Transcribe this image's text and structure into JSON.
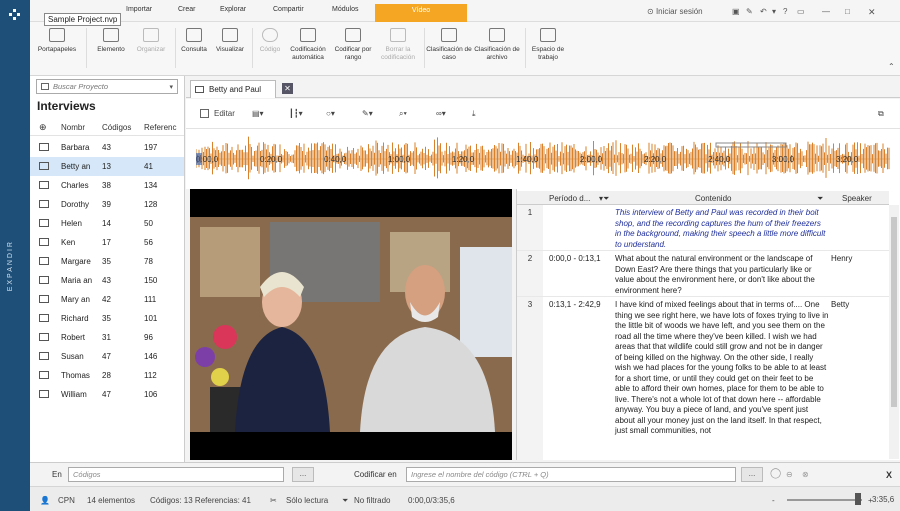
{
  "sidebar": {
    "expand_label": "EXPANDIR"
  },
  "tooltip": "Sample Project.nvp",
  "menu": {
    "tabs": [
      "Importar",
      "Crear",
      "Explorar",
      "Compartir",
      "Módulos",
      "Vídeo"
    ],
    "active": "Vídeo",
    "signin_label": "Iniciar sesión"
  },
  "ribbon": {
    "buttons": [
      "Portapapeles",
      "Elemento",
      "Organizar",
      "Consulta",
      "Visualizar",
      "Código",
      "Codificación automática",
      "Codificar por rango",
      "Borrar la codificación",
      "Clasificación de caso",
      "Clasificación de archivo",
      "Espacio de trabajo"
    ]
  },
  "nav": {
    "search_placeholder": "Buscar Proyecto",
    "title": "Interviews",
    "columns": {
      "name": "Nombr",
      "codes": "Códigos",
      "refs": "Referenc"
    },
    "rows": [
      {
        "name": "Barbara",
        "codes": "43",
        "refs": "197",
        "icon": "document-icon"
      },
      {
        "name": "Betty an",
        "codes": "13",
        "refs": "41",
        "icon": "video-icon",
        "selected": true
      },
      {
        "name": "Charles",
        "codes": "38",
        "refs": "134",
        "icon": "document-icon"
      },
      {
        "name": "Dorothy",
        "codes": "39",
        "refs": "128",
        "icon": "document-icon"
      },
      {
        "name": "Helen",
        "codes": "14",
        "refs": "50",
        "icon": "audio-icon"
      },
      {
        "name": "Ken",
        "codes": "17",
        "refs": "56",
        "icon": "video-icon"
      },
      {
        "name": "Margare",
        "codes": "35",
        "refs": "78",
        "icon": "document-icon"
      },
      {
        "name": "Maria an",
        "codes": "43",
        "refs": "150",
        "icon": "document-icon"
      },
      {
        "name": "Mary an",
        "codes": "42",
        "refs": "111",
        "icon": "document-icon"
      },
      {
        "name": "Richard",
        "codes": "35",
        "refs": "101",
        "icon": "document-icon"
      },
      {
        "name": "Robert",
        "codes": "31",
        "refs": "96",
        "icon": "document-icon"
      },
      {
        "name": "Susan",
        "codes": "47",
        "refs": "146",
        "icon": "document-icon"
      },
      {
        "name": "Thomas",
        "codes": "28",
        "refs": "112",
        "icon": "document-icon"
      },
      {
        "name": "William",
        "codes": "47",
        "refs": "106",
        "icon": "document-icon"
      }
    ]
  },
  "document": {
    "tab_label": "Betty and Paul",
    "edit_label": "Editar",
    "timeline_ticks": [
      "0:00,0",
      "0:20,0",
      "0:40,0",
      "1:00,0",
      "1:20,0",
      "1:40,0",
      "2:00,0",
      "2:20,0",
      "2:40,0",
      "3:00,0",
      "3:20,0"
    ]
  },
  "transcript": {
    "columns": {
      "range": "Período d...",
      "content": "Contenido",
      "speaker": "Speaker"
    },
    "rows": [
      {
        "num": "1",
        "range": "",
        "content": "This interview of Betty and Paul was recorded in their boit shop, and the recording captures the hum of their freezers in the background, making their speech a little more difficult to understand.",
        "speaker": "",
        "note": true
      },
      {
        "num": "2",
        "range": "0:00,0 - 0:13,1",
        "content": "What about the natural environment or the landscape of Down East? Are there things that you particularly like or value about the environment here, or don't like about the environment here?",
        "speaker": "Henry"
      },
      {
        "num": "3",
        "range": "0:13,1 - 2:42,9",
        "content": "I have kind of mixed feelings about that in terms of.... One thing we see right here, we have lots of foxes trying to live in the little bit of woods we have left, and you see them on the road all the time where they've been killed. I wish we had areas that that wildlife could still grow and not be in danger of being killed on the highway. On the other side, I really wish we had places for the young folks to be able to at least for a short time, or until they could get on their feet to be able to afford their own homes, place for them to be able to live. There's not a whole lot of that down here -- affordable anyway. You buy a piece of land, and you've spent just about all your money just on the land itself. In that respect, just small communities, not",
        "speaker": "Betty"
      }
    ]
  },
  "coding_bar": {
    "in_label": "En",
    "codes_placeholder": "Códigos",
    "code_in_label": "Codificar en",
    "code_input_placeholder": "Ingrese el nombre del código (CTRL + Q)",
    "more_label": "...",
    "close_label": "X"
  },
  "status": {
    "user": "CPN",
    "items": "14 elementos",
    "codes_refs": "Códigos: 13  Referencias: 41",
    "readonly": "Sólo lectura",
    "filter": "No filtrado",
    "position": "0:00,0/3:35,6",
    "duration": "3:35,6",
    "zoom_minus": "-",
    "zoom_plus": "+"
  }
}
